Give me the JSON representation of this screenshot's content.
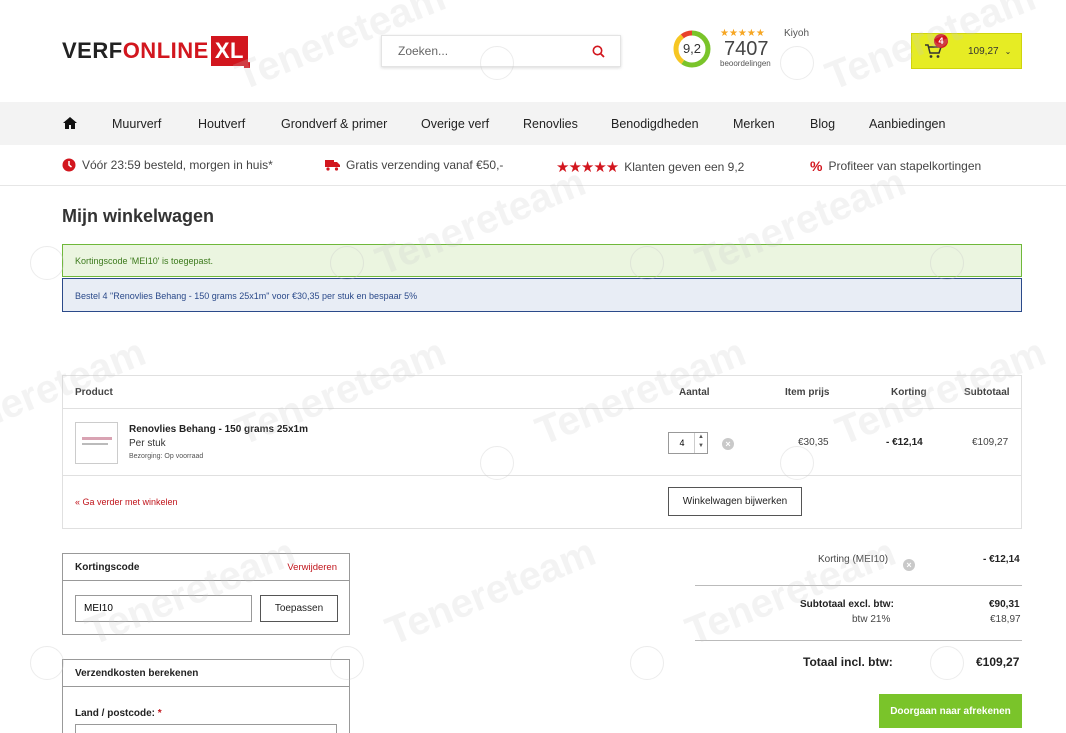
{
  "brand": {
    "part1": "VERF",
    "part2": "ONLINE",
    "part3": "XL"
  },
  "search": {
    "placeholder": "Zoeken..."
  },
  "rating": {
    "score": "9,2",
    "count": "7407",
    "count_label": "beoordelingen",
    "provider": "Kiyoh",
    "stars": "★★★★★"
  },
  "cart": {
    "count": "4",
    "amount": "109,27",
    "chevron": "⌄"
  },
  "nav": {
    "items": [
      "Muurverf",
      "Houtverf",
      "Grondverf & primer",
      "Overige verf",
      "Renovlies",
      "Benodigdheden",
      "Merken",
      "Blog",
      "Aanbiedingen"
    ]
  },
  "usps": [
    {
      "text": "Vóór 23:59 besteld, morgen in huis*",
      "icon": "clock-icon"
    },
    {
      "text": "Gratis verzending vanaf €50,-",
      "icon": "truck-icon"
    },
    {
      "text": "Klanten geven een 9,2",
      "icon": "stars-icon"
    },
    {
      "text": "Profiteer van stapelkortingen",
      "icon": "percent-icon"
    }
  ],
  "page_title": "Mijn winkelwagen",
  "alerts": {
    "success": "Kortingscode 'MEI10' is toegepast.",
    "info": "Bestel 4 \"Renovlies Behang - 150 grams 25x1m\" voor €30,35 per stuk en bespaar 5%"
  },
  "table": {
    "headers": {
      "product": "Product",
      "quantity": "Aantal",
      "item_price": "Item prijs",
      "discount": "Korting",
      "subtotal": "Subtotaal"
    },
    "rows": [
      {
        "name": "Renovlies Behang - 150 grams 25x1m",
        "unit": "Per stuk",
        "delivery": "Bezorging: Op voorraad",
        "quantity": "4",
        "item_price": "€30,35",
        "discount": "- €12,14",
        "subtotal": "€109,27"
      }
    ],
    "continue_link": "« Ga verder met winkelen",
    "update_button": "Winkelwagen bijwerken"
  },
  "coupon": {
    "title": "Kortingscode",
    "remove_link": "Verwijderen",
    "value": "MEI10",
    "apply_button": "Toepassen"
  },
  "shipping": {
    "title": "Verzendkosten berekenen",
    "field_label": "Land / postcode:",
    "required_mark": "*"
  },
  "totals": {
    "discount_label": "Korting (MEI10)",
    "discount_value": "- €12,14",
    "subtotal_label": "Subtotaal excl. btw:",
    "subtotal_value": "€90,31",
    "vat_label": "btw 21%",
    "vat_value": "€18,97",
    "total_label": "Totaal incl. btw:",
    "total_value": "€109,27",
    "checkout_button": "Doorgaan naar afrekenen"
  },
  "watermark": "Tenereteam",
  "colors": {
    "brand_red": "#d2161e",
    "cart_yellow": "#e6ec24",
    "checkout_green": "#7ac42a",
    "success_green": "#6fb83a",
    "info_blue": "#2b4a8a"
  }
}
